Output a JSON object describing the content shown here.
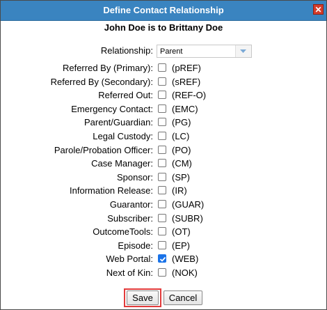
{
  "dialog": {
    "title": "Define Contact Relationship",
    "close_glyph": "✕"
  },
  "heading": {
    "person": "John Doe",
    "connector": " is to ",
    "target": "Brittany Doe"
  },
  "relationship": {
    "label": "Relationship:",
    "selected": "Parent"
  },
  "checkboxes": [
    {
      "label": "Referred By (Primary):",
      "code": "(pREF)",
      "checked": false
    },
    {
      "label": "Referred By (Secondary):",
      "code": "(sREF)",
      "checked": false
    },
    {
      "label": "Referred Out:",
      "code": "(REF-O)",
      "checked": false
    },
    {
      "label": "Emergency Contact:",
      "code": "(EMC)",
      "checked": false
    },
    {
      "label": "Parent/Guardian:",
      "code": "(PG)",
      "checked": false
    },
    {
      "label": "Legal Custody:",
      "code": "(LC)",
      "checked": false
    },
    {
      "label": "Parole/Probation Officer:",
      "code": "(PO)",
      "checked": false
    },
    {
      "label": "Case Manager:",
      "code": "(CM)",
      "checked": false
    },
    {
      "label": "Sponsor:",
      "code": "(SP)",
      "checked": false
    },
    {
      "label": "Information Release:",
      "code": "(IR)",
      "checked": false
    },
    {
      "label": "Guarantor:",
      "code": "(GUAR)",
      "checked": false
    },
    {
      "label": "Subscriber:",
      "code": "(SUBR)",
      "checked": false
    },
    {
      "label": "OutcomeTools:",
      "code": "(OT)",
      "checked": false
    },
    {
      "label": "Episode:",
      "code": "(EP)",
      "checked": false
    },
    {
      "label": "Web Portal:",
      "code": "(WEB)",
      "checked": true
    },
    {
      "label": "Next of Kin:",
      "code": "(NOK)",
      "checked": false
    }
  ],
  "buttons": {
    "save": "Save",
    "cancel": "Cancel"
  },
  "colors": {
    "titlebar": "#3a84c0",
    "checked": "#1a73e8",
    "highlight": "#e23b3b"
  }
}
